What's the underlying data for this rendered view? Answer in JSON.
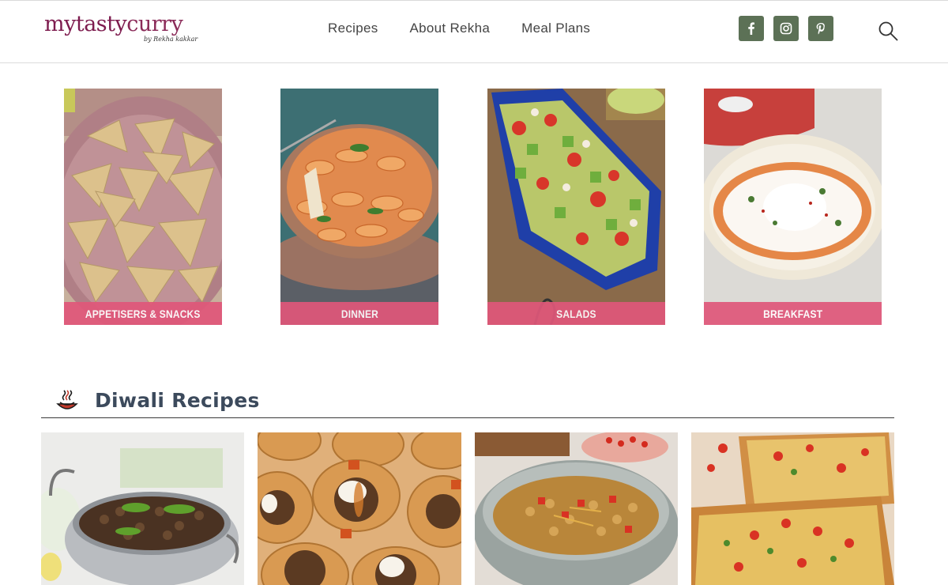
{
  "header": {
    "logo": {
      "main_a": "mytasty",
      "main_b": "curry",
      "byline": "by Rekha kakkar"
    },
    "nav": [
      "Recipes",
      "About Rekha",
      "Meal Plans"
    ],
    "social": [
      {
        "icon": "facebook-icon"
      },
      {
        "icon": "instagram-icon"
      },
      {
        "icon": "pinterest-icon"
      }
    ],
    "search_icon": "search-icon"
  },
  "categories": [
    {
      "label": "APPETISERS & SNACKS"
    },
    {
      "label": "DINNER"
    },
    {
      "label": "SALADS"
    },
    {
      "label": "BREAKFAST"
    }
  ],
  "section": {
    "title": "Diwali Recipes",
    "icon": "diya-icon"
  },
  "colors": {
    "brand": "#7d1b4e",
    "social_bg": "#5c7156",
    "category_band": "#e0577a",
    "section_title": "#3c4a5c"
  }
}
